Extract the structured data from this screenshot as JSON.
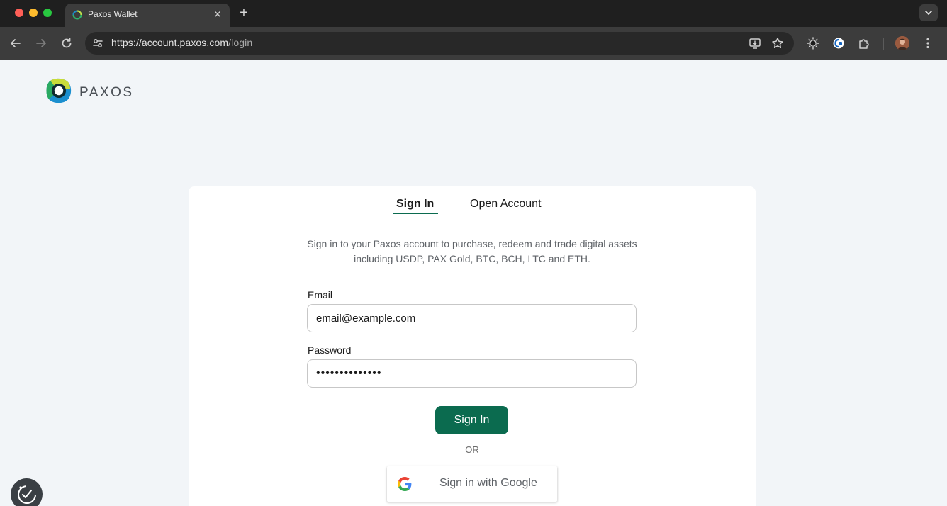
{
  "browser": {
    "tab_title": "Paxos Wallet",
    "tab_close": "✕",
    "new_tab": "+",
    "url_host": "https://account.paxos.com",
    "url_path": "/login",
    "toolbar_icons": [
      "back-arrow-icon",
      "forward-arrow-icon",
      "reload-icon",
      "site-info-icon",
      "install-app-icon",
      "bookmark-star-icon",
      "extension-sun-icon",
      "extension-shield-icon",
      "extensions-puzzle-icon",
      "profile-avatar",
      "more-menu-icon"
    ]
  },
  "header": {
    "logo_text": "PAXOS"
  },
  "auth": {
    "tabs": [
      {
        "label": "Sign In",
        "active": true
      },
      {
        "label": "Open Account",
        "active": false
      }
    ],
    "intro": "Sign in to your Paxos account to purchase, redeem and trade digital assets including USDP, PAX Gold, BTC, BCH, LTC and ETH.",
    "email": {
      "label": "Email",
      "value": "email@example.com"
    },
    "password": {
      "label": "Password",
      "value": "••••••••••••••"
    },
    "signin_button": "Sign In",
    "or_text": "OR",
    "google_button": "Sign in with Google"
  },
  "colors": {
    "brand_green": "#0b6b4f",
    "page_bg": "#f2f5f8",
    "chrome_bg": "#3c3c3c"
  }
}
